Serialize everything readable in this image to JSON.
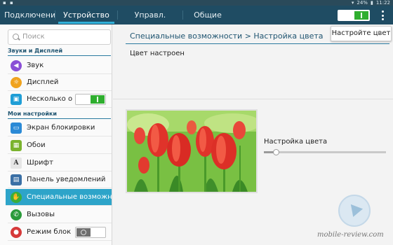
{
  "status_bar": {
    "battery": "24%",
    "time": "11:22"
  },
  "tabs": [
    {
      "label": "Подключения"
    },
    {
      "label": "Устройство"
    },
    {
      "label": "Управл."
    },
    {
      "label": "Общие"
    }
  ],
  "sidebar": {
    "search_placeholder": "Поиск",
    "sections": [
      {
        "title": "Звуки и Дисплей"
      },
      {
        "title": "Мои настройки"
      }
    ],
    "items": [
      {
        "label": "Звук",
        "icon": "speaker-icon",
        "color": "#8a4fd6"
      },
      {
        "label": "Дисплей",
        "icon": "display-icon",
        "color": "#f0a31f"
      },
      {
        "label": "Несколько о",
        "icon": "multiwindow-icon",
        "color": "#1f9ed6",
        "toggle": "on"
      },
      {
        "label": "Экран блокировки",
        "icon": "lockscreen-icon",
        "color": "#2b8ad6"
      },
      {
        "label": "Обои",
        "icon": "wallpaper-icon",
        "color": "#7ab32e"
      },
      {
        "label": "Шрифт",
        "icon": "font-icon",
        "color": "#9a9a9a"
      },
      {
        "label": "Панель уведомлений",
        "icon": "notification-panel-icon",
        "color": "#3a6fa5"
      },
      {
        "label": "Специальные возможнос",
        "icon": "accessibility-icon",
        "color": "#3cae3a",
        "active": true
      },
      {
        "label": "Вызовы",
        "icon": "phone-icon",
        "color": "#2a9a3a"
      },
      {
        "label": "Режим блок",
        "icon": "block-mode-icon",
        "color": "#d63a3a",
        "toggle": "off"
      }
    ]
  },
  "content": {
    "breadcrumb": "Специальные возможности > Настройка цвета",
    "adjust_button": "Настройте цвет",
    "status_text": "Цвет настроен",
    "slider_label": "Настройка цвета",
    "slider_value_pct": 10
  },
  "watermark": {
    "text": "mobile-review.com"
  },
  "colors": {
    "tab_bar": "#1f4c63",
    "accent": "#2da4c9",
    "toggle_on": "#2fae2f"
  }
}
